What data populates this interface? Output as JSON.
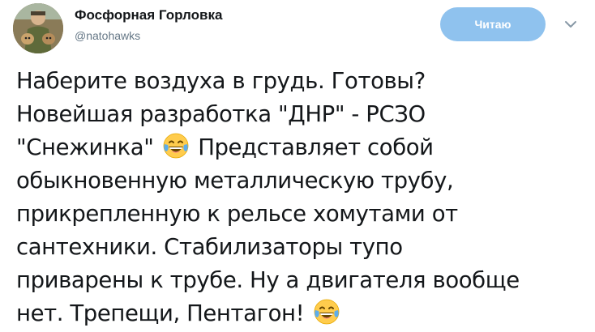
{
  "author": {
    "display_name": "Фосфорная Горловка",
    "handle": "@natohawks"
  },
  "actions": {
    "follow_label": "Читаю",
    "menu_icon": "chevron-down-icon"
  },
  "colors": {
    "follow_button_bg": "#8fc2ee",
    "text": "#14171a",
    "secondary_text": "#657786"
  },
  "tweet": {
    "lines": [
      "Наберите воздуха в грудь. Готовы?",
      "Новейшая разработка \"ДНР\" - РСЗО",
      "\"Снежинка\"",
      "Представляет собой",
      "обыкновенную металлическую трубу,",
      "прикрепленную к рельсе хомутами от",
      "сантехники. Стабилизаторы тупо",
      "приварены к трубе. Ну а двигателя вообще",
      "нет. Трепещи, Пентагон!"
    ],
    "emoji": "face-with-tears-of-joy"
  }
}
